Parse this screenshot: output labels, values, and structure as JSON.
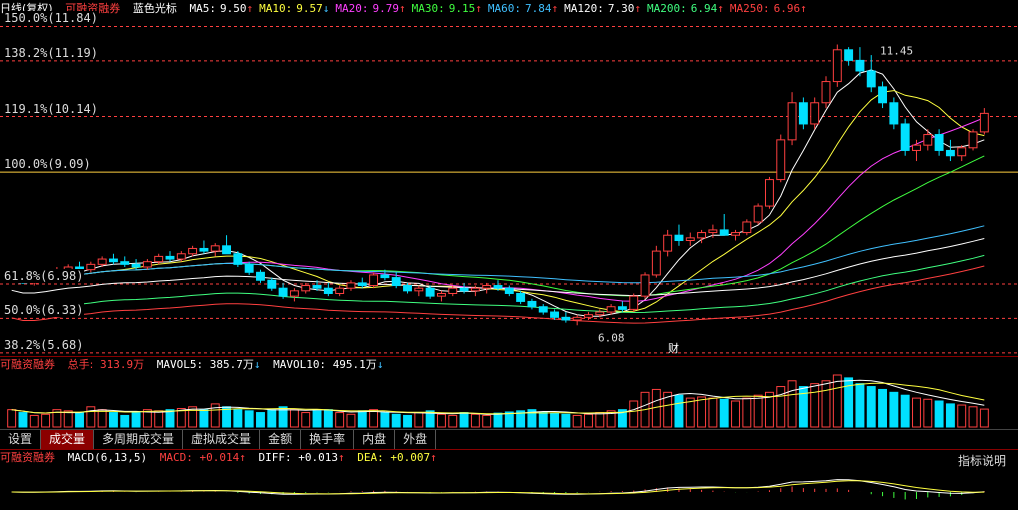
{
  "header": {
    "period": "日线(复权)",
    "stock": "可融资融券",
    "indicator": "蓝色光标",
    "ma": [
      {
        "label": "MA5:",
        "value": "9.50",
        "arrow": "↑",
        "color": "#ffffff"
      },
      {
        "label": "MA10:",
        "value": "9.57",
        "arrow": "↓",
        "color": "#ffff40"
      },
      {
        "label": "MA20:",
        "value": "9.79",
        "arrow": "↑",
        "color": "#ff40ff"
      },
      {
        "label": "MA30:",
        "value": "9.15",
        "arrow": "↑",
        "color": "#40ff40"
      },
      {
        "label": "MA60:",
        "value": "7.84",
        "arrow": "↑",
        "color": "#40c0ff"
      },
      {
        "label": "MA120:",
        "value": "7.30",
        "arrow": "↑",
        "color": "#ffffff"
      },
      {
        "label": "MA200:",
        "value": "6.94",
        "arrow": "↑",
        "color": "#40ff80"
      },
      {
        "label": "MA250:",
        "value": "6.96",
        "arrow": "↑",
        "color": "#ff4040"
      }
    ]
  },
  "levels": [
    {
      "text": "150.0%(11.84)",
      "price": 11.84
    },
    {
      "text": "138.2%(11.19)",
      "price": 11.19
    },
    {
      "text": "119.1%(10.14)",
      "price": 10.14
    },
    {
      "text": "100.0%(9.09)",
      "price": 9.09
    },
    {
      "text": "61.8%(6.98)",
      "price": 6.98
    },
    {
      "text": "50.0%(6.33)",
      "price": 6.33
    },
    {
      "text": "38.2%(5.68)",
      "price": 5.68
    }
  ],
  "annotations": {
    "high": "11.45",
    "low": "6.08",
    "event": "财"
  },
  "volume": {
    "stock": "可融资融券",
    "total_label": "总手:",
    "total": "313.9万",
    "mavol5_label": "MAVOL5:",
    "mavol5": "385.7万",
    "mavol5_arrow": "↓",
    "mavol10_label": "MAVOL10:",
    "mavol10": "495.1万",
    "mavol10_arrow": "↓"
  },
  "tabs": [
    "设置",
    "成交量",
    "多周期成交量",
    "虚拟成交量",
    "金额",
    "换手率",
    "内盘",
    "外盘"
  ],
  "active_tab": "成交量",
  "macd": {
    "stock": "可融资融券",
    "name": "MACD(6,13,5)",
    "macd_label": "MACD:",
    "macd": "+0.014",
    "macd_arrow": "↑",
    "diff_label": "DIFF:",
    "diff": "+0.013",
    "diff_arrow": "↑",
    "dea_label": "DEA:",
    "dea": "+0.007",
    "dea_arrow": "↑",
    "help": "指标说明"
  },
  "colors": {
    "up": "#ff4040",
    "down": "#00e0ff",
    "level": "#ff4040",
    "base": "#ffd040"
  },
  "chart_data": {
    "type": "candlestick",
    "price_range": [
      5.62,
      12.0
    ],
    "candles": [
      [
        7.05,
        7.15,
        7.0,
        7.1
      ],
      [
        7.1,
        7.15,
        6.98,
        7.0
      ],
      [
        7.0,
        7.1,
        6.95,
        7.05
      ],
      [
        7.05,
        7.2,
        7.0,
        7.15
      ],
      [
        7.15,
        7.3,
        7.1,
        7.25
      ],
      [
        7.25,
        7.35,
        7.15,
        7.3
      ],
      [
        7.3,
        7.4,
        7.2,
        7.25
      ],
      [
        7.25,
        7.4,
        7.2,
        7.35
      ],
      [
        7.35,
        7.5,
        7.3,
        7.45
      ],
      [
        7.45,
        7.55,
        7.35,
        7.4
      ],
      [
        7.4,
        7.5,
        7.3,
        7.35
      ],
      [
        7.35,
        7.45,
        7.25,
        7.3
      ],
      [
        7.3,
        7.45,
        7.25,
        7.4
      ],
      [
        7.4,
        7.55,
        7.35,
        7.5
      ],
      [
        7.5,
        7.6,
        7.4,
        7.45
      ],
      [
        7.45,
        7.6,
        7.4,
        7.55
      ],
      [
        7.55,
        7.7,
        7.5,
        7.65
      ],
      [
        7.65,
        7.8,
        7.55,
        7.6
      ],
      [
        7.6,
        7.75,
        7.5,
        7.7
      ],
      [
        7.7,
        7.9,
        7.65,
        7.55
      ],
      [
        7.55,
        7.6,
        7.3,
        7.35
      ],
      [
        7.35,
        7.4,
        7.15,
        7.2
      ],
      [
        7.2,
        7.25,
        7.0,
        7.05
      ],
      [
        7.05,
        7.1,
        6.85,
        6.9
      ],
      [
        6.9,
        7.0,
        6.7,
        6.75
      ],
      [
        6.75,
        6.9,
        6.65,
        6.85
      ],
      [
        6.85,
        7.0,
        6.8,
        6.95
      ],
      [
        6.95,
        7.05,
        6.85,
        6.9
      ],
      [
        6.9,
        7.0,
        6.75,
        6.8
      ],
      [
        6.8,
        6.95,
        6.75,
        6.9
      ],
      [
        6.9,
        7.05,
        6.85,
        7.0
      ],
      [
        7.0,
        7.1,
        6.9,
        6.95
      ],
      [
        6.95,
        7.2,
        6.9,
        7.15
      ],
      [
        7.15,
        7.25,
        7.05,
        7.1
      ],
      [
        7.1,
        7.2,
        6.9,
        6.95
      ],
      [
        6.95,
        7.0,
        6.8,
        6.85
      ],
      [
        6.85,
        6.95,
        6.75,
        6.9
      ],
      [
        6.9,
        6.95,
        6.7,
        6.75
      ],
      [
        6.75,
        6.85,
        6.65,
        6.8
      ],
      [
        6.8,
        6.95,
        6.75,
        6.9
      ],
      [
        6.9,
        7.0,
        6.8,
        6.85
      ],
      [
        6.85,
        6.95,
        6.75,
        6.9
      ],
      [
        6.9,
        7.0,
        6.8,
        6.95
      ],
      [
        6.95,
        7.05,
        6.85,
        6.9
      ],
      [
        6.9,
        6.95,
        6.75,
        6.8
      ],
      [
        6.8,
        6.85,
        6.6,
        6.65
      ],
      [
        6.65,
        6.7,
        6.5,
        6.55
      ],
      [
        6.55,
        6.6,
        6.4,
        6.45
      ],
      [
        6.45,
        6.5,
        6.3,
        6.35
      ],
      [
        6.35,
        6.45,
        6.25,
        6.3
      ],
      [
        6.3,
        6.4,
        6.2,
        6.35
      ],
      [
        6.35,
        6.45,
        6.3,
        6.4
      ],
      [
        6.4,
        6.5,
        6.35,
        6.45
      ],
      [
        6.45,
        6.6,
        6.4,
        6.55
      ],
      [
        6.55,
        6.65,
        6.45,
        6.5
      ],
      [
        6.5,
        6.8,
        6.45,
        6.75
      ],
      [
        6.75,
        7.2,
        6.7,
        7.15
      ],
      [
        7.15,
        7.7,
        7.1,
        7.6
      ],
      [
        7.6,
        8.0,
        7.5,
        7.9
      ],
      [
        7.9,
        8.1,
        7.7,
        7.8
      ],
      [
        7.8,
        7.95,
        7.7,
        7.85
      ],
      [
        7.85,
        8.0,
        7.75,
        7.95
      ],
      [
        7.95,
        8.1,
        7.85,
        8.0
      ],
      [
        8.0,
        8.3,
        7.9,
        7.9
      ],
      [
        7.9,
        8.0,
        7.8,
        7.95
      ],
      [
        7.95,
        8.2,
        7.9,
        8.15
      ],
      [
        8.15,
        8.5,
        8.1,
        8.45
      ],
      [
        8.45,
        9.0,
        8.4,
        8.95
      ],
      [
        8.95,
        9.8,
        8.9,
        9.7
      ],
      [
        9.7,
        10.6,
        9.6,
        10.4
      ],
      [
        10.4,
        10.5,
        9.9,
        10.0
      ],
      [
        10.0,
        10.5,
        9.9,
        10.4
      ],
      [
        10.4,
        10.9,
        10.3,
        10.8
      ],
      [
        10.8,
        11.5,
        10.7,
        11.4
      ],
      [
        11.4,
        11.45,
        11.1,
        11.2
      ],
      [
        11.2,
        11.45,
        10.9,
        11.0
      ],
      [
        11.0,
        11.3,
        10.6,
        10.7
      ],
      [
        10.7,
        10.8,
        10.3,
        10.4
      ],
      [
        10.4,
        10.5,
        9.9,
        10.0
      ],
      [
        10.0,
        10.1,
        9.4,
        9.5
      ],
      [
        9.5,
        9.7,
        9.3,
        9.6
      ],
      [
        9.6,
        9.9,
        9.5,
        9.8
      ],
      [
        9.8,
        9.9,
        9.4,
        9.5
      ],
      [
        9.5,
        9.7,
        9.3,
        9.4
      ],
      [
        9.4,
        9.6,
        9.3,
        9.55
      ],
      [
        9.55,
        9.9,
        9.5,
        9.85
      ],
      [
        9.85,
        10.3,
        9.8,
        10.2
      ]
    ],
    "volumes": [
      3,
      2.5,
      2,
      2.2,
      3,
      2.8,
      2.5,
      3.5,
      3,
      2.5,
      2,
      2.5,
      3,
      2.8,
      3,
      3.2,
      3.5,
      3,
      4,
      3.5,
      3,
      2.8,
      2.5,
      3,
      3.5,
      3,
      2.5,
      2.8,
      3,
      2.5,
      2.2,
      2.8,
      3,
      2.5,
      2.2,
      2,
      2.5,
      2.8,
      2.2,
      2,
      2.5,
      2.2,
      2,
      2.4,
      2.6,
      2.8,
      3,
      2.6,
      2.4,
      2.2,
      2,
      2.2,
      2.5,
      2.8,
      3,
      4.5,
      6,
      6.5,
      6,
      5.5,
      5,
      5.2,
      5,
      4.8,
      4.5,
      5,
      5.5,
      6,
      7,
      8,
      7,
      7.5,
      8,
      9,
      8.5,
      7.5,
      7,
      6.5,
      6,
      5.5,
      5,
      4.8,
      4.5,
      4,
      3.8,
      3.5,
      3.1
    ],
    "ma_series": [
      {
        "name": "MA5",
        "color": "#ffffff"
      },
      {
        "name": "MA10",
        "color": "#ffff40"
      },
      {
        "name": "MA20",
        "color": "#ff40ff"
      },
      {
        "name": "MA30",
        "color": "#40ff40"
      },
      {
        "name": "MA60",
        "color": "#40c0ff"
      },
      {
        "name": "MA120",
        "color": "#ffffff"
      },
      {
        "name": "MA200",
        "color": "#40ff80"
      },
      {
        "name": "MA250",
        "color": "#ff4040"
      }
    ]
  }
}
